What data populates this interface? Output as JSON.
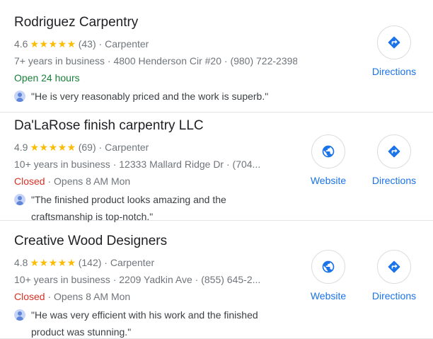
{
  "listings": [
    {
      "name": "Rodriguez Carpentry",
      "rating": "4.6",
      "stars": "★★★★★",
      "reviews": "(43)",
      "category": "Carpenter",
      "details": "7+ years in business · 4800 Henderson Cir #20 · (980) 722-2398",
      "status": "Open 24 hours",
      "hours": "",
      "review": "\"He is very reasonably priced and the work is superb.\"",
      "website_label": "",
      "directions_label": "Directions"
    },
    {
      "name": "Da'LaRose finish carpentry LLC",
      "rating": "4.9",
      "stars": "★★★★★",
      "reviews": "(69)",
      "category": "Carpenter",
      "details": "10+ years in business · 12333 Mallard Ridge Dr · (704...",
      "status": "Closed",
      "hours": " · Opens 8 AM Mon",
      "review": "\"The finished product looks amazing and the craftsmanship is top-notch.\"",
      "website_label": "Website",
      "directions_label": "Directions"
    },
    {
      "name": "Creative Wood Designers",
      "rating": "4.8",
      "stars": "★★★★★",
      "reviews": "(142)",
      "category": "Carpenter",
      "details": "10+ years in business · 2209 Yadkin Ave · (855) 645-2...",
      "status": "Closed",
      "hours": " · Opens 8 AM Mon",
      "review": "\"He was very efficient with his work and the finished product was stunning.\"",
      "website_label": "Website",
      "directions_label": "Directions"
    }
  ],
  "colors": {
    "link": "#1a73e8",
    "open": "#188038",
    "closed": "#d93025",
    "star": "#fbbc04"
  },
  "icons": {
    "website": "globe-icon",
    "directions": "directions-icon",
    "reviewer": "avatar-icon"
  }
}
